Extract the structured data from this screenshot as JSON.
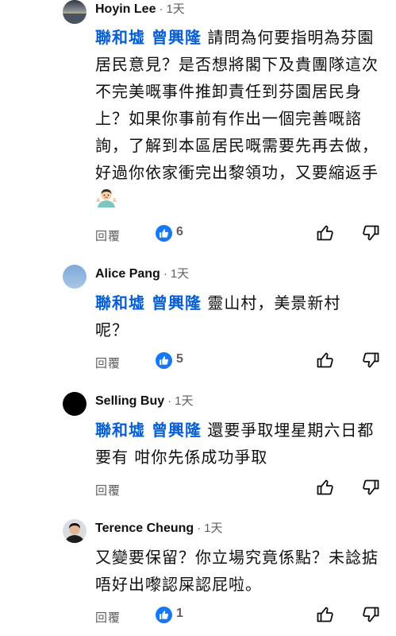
{
  "comments": [
    {
      "author": "Hoyin Lee",
      "separator": "·",
      "time": "1天",
      "mention": "聯和墟 曾興隆",
      "text": "請問為何要指明為芬園居民意見？是否想將閣下及貴團隊這次不完美嘅事件推卸責任到芬園居民身上？如果你事前有作出一個完善嘅諮詢，了解到本區居民嘅需要先再去做，好過你依家衝完出黎領功，又要縮返手",
      "emoji": "man-shrugging",
      "reply_label": "回覆",
      "like_count": "6"
    },
    {
      "author": "Alice Pang",
      "separator": "·",
      "time": "1天",
      "mention": "聯和墟 曾興隆",
      "text": "靈山村，美景新村呢？",
      "reply_label": "回覆",
      "like_count": "5"
    },
    {
      "author": "Selling Buy",
      "separator": "·",
      "time": "1天",
      "mention": "聯和墟 曾興隆",
      "text": "還要爭取埋星期六日都要有 咁你先係成功￼爭取",
      "reply_label": "回覆",
      "like_count": ""
    },
    {
      "author": "Terence  Cheung",
      "separator": "·",
      "time": "1天",
      "mention": "",
      "text": "又變要保留？你立場究竟係點？未諗掂唔好出嚟認屎認屁啦。",
      "reply_label": "回覆",
      "like_count": "1"
    }
  ],
  "colors": {
    "mention": "#065fd4",
    "like_badge": "#1877f2",
    "secondary_text": "#606060",
    "primary_text": "#0f0f0f"
  },
  "icons": {
    "like_badge": "thumbs-up-icon",
    "like_button": "thumb-up-outline-icon",
    "dislike_button": "thumb-down-outline-icon"
  }
}
